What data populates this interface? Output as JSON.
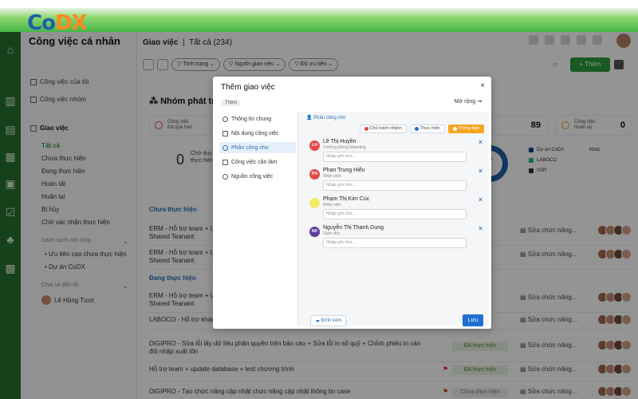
{
  "brand": {
    "co": "Co",
    "dx": "DX"
  },
  "sidebar": {
    "title": "Công việc cá nhân",
    "items": [
      {
        "label": "Công việc của tôi"
      },
      {
        "label": "Công việc nhóm"
      },
      {
        "label": "Giao việc"
      }
    ],
    "sub_items": [
      "Tất cả",
      "Chưa thực hiện",
      "Đang thực hiện",
      "Hoàn tất",
      "Hoãn lại",
      "Bị hủy",
      "Chờ xác nhận thực hiện"
    ],
    "section_expand": "Danh sách mở rộng",
    "expand_items": [
      "Ưu tiên cao chưa thực hiện",
      "Dự án CoDX"
    ],
    "section_shared": "Chia sẻ đến tôi",
    "shared_user": "Lê Hồng Tươi"
  },
  "header": {
    "title": "Giao việc",
    "count": "Tất cả (234)"
  },
  "filters": {
    "status": "Tình trạng",
    "assigner": "Người giao việc",
    "priority": "Độ ưu tiên"
  },
  "toolbar": {
    "add_label": "+ Thêm"
  },
  "group": {
    "title": "Nhóm phát tr"
  },
  "stats": [
    {
      "label": "Công việc\nĐã quá hạn",
      "color": "#e24b4b"
    },
    {
      "label": "",
      "num": "89",
      "color": "#1f5fa8"
    },
    {
      "label": "Công việc\nHoãn lại",
      "num": "0",
      "color": "#f5a623"
    }
  ],
  "mid_stat": {
    "num": "0",
    "label": "Chờ duy\nthực hiện"
  },
  "donut": {
    "value": "4"
  },
  "legend": [
    {
      "label": "Dự án CoDX",
      "color": "#1f3f8a"
    },
    {
      "label": "LABOCO",
      "color": "#2bb0a2"
    },
    {
      "label": "SSR",
      "color": "#333333"
    }
  ],
  "legend_other": "Khác",
  "sections": {
    "not_started": "Chưa thực hiện",
    "in_progress": "Đang thực hiện"
  },
  "rows": [
    {
      "text": "ERM - Hỗ trợ team + U\nShared Teanant",
      "status": "",
      "doc": "Sửa chức năng..."
    },
    {
      "text": "ERM - Hỗ trợ team + U\nShared Teanant",
      "status": "",
      "doc": "Sửa chức năng..."
    },
    {
      "text": "ERM - Hỗ trợ team + U\nShared Teanant",
      "status": "",
      "doc": "Sửa chức năng..."
    },
    {
      "text": "LABOCO - Hỗ trợ khác",
      "status": "",
      "doc": "Sửa chức năng..."
    },
    {
      "text": "DIGIPRO - Sửa lỗi lấy dữ liệu phân quyền trên báo cáo + Sửa lỗi in sổ quỹ + Chỉnh phiếu in cán\nđối nhập xuất tồn",
      "status": "Đã thực hiện",
      "doc": "Sửa chức năng..."
    },
    {
      "text": "Hỗ trợ team + update database + test chương trình",
      "status": "Đã thực hiện",
      "doc": "Sửa chức năng..."
    },
    {
      "text": "DIGIPRO - Tạo chức năng cập nhật chức năng cập nhật thông tin case",
      "status": "Chưa thực hiện",
      "doc": "Sửa chức năng..."
    }
  ],
  "modal": {
    "title": "Thêm giao việc",
    "close": "×",
    "tag": "Thêm",
    "expand": "Mở rộng",
    "nav": [
      "Thông tin chung",
      "Nội dung công việc",
      "Phân công cho",
      "Công việc cần làm",
      "Nguồn công việc"
    ],
    "section": "Phân công cho",
    "roles": [
      {
        "label": "Chủ trách nhiệm",
        "color": "#e24b4b"
      },
      {
        "label": "Thực hiện",
        "color": "#1f6fd1"
      },
      {
        "label": "Thông báo",
        "color": "#ffffff"
      }
    ],
    "people": [
      {
        "initials": "LH",
        "name": "Lê Thị Huyền",
        "role": "Trưởng phòng Maketing",
        "color": "#e24b4b",
        "placeholder": "Nhập ghi chú..."
      },
      {
        "initials": "PH",
        "name": "Phan Trung Hiếu",
        "role": "Nhân viên",
        "color": "#e24b4b",
        "placeholder": "Nhập ghi chú..."
      },
      {
        "initials": "",
        "name": "Phạm Thị Kim Cúc",
        "role": "Nhân viên",
        "color": "#f6e96b",
        "placeholder": "Nhập ghi chú..."
      },
      {
        "initials": "ND",
        "name": "Nguyễn Thị Thanh Dung",
        "role": "Giám đốc",
        "color": "#5a3c9a",
        "placeholder": "Nhập ghi chú..."
      }
    ],
    "attach": "Đính kèm",
    "save": "Lưu"
  }
}
